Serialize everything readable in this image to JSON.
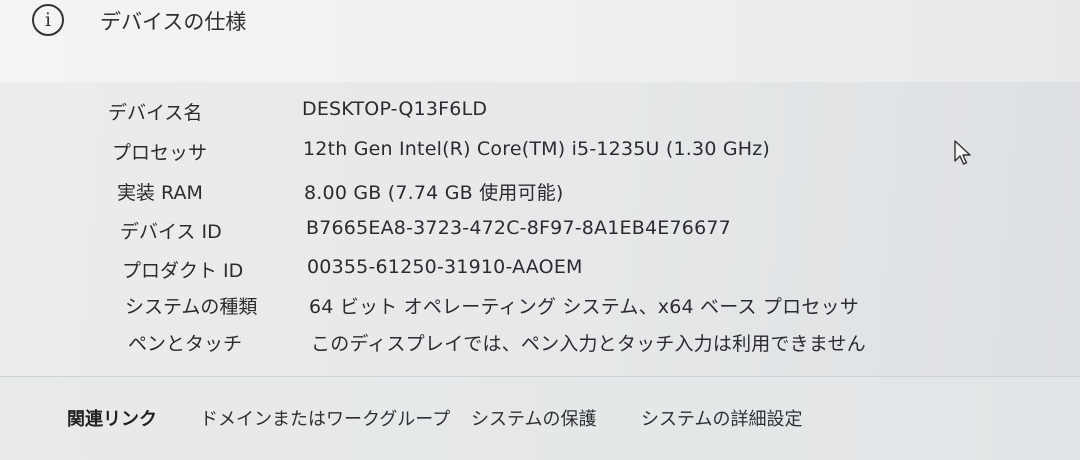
{
  "header": {
    "title": "デバイスの仕様",
    "info_icon": "i"
  },
  "specs": [
    {
      "label": "デバイス名",
      "value": "DESKTOP-Q13F6LD"
    },
    {
      "label": "プロセッサ",
      "value": "12th Gen Intel(R) Core(TM) i5-1235U (1.30 GHz)"
    },
    {
      "label": "実装 RAM",
      "value": "8.00 GB (7.74 GB 使用可能)"
    },
    {
      "label": "デバイス ID",
      "value": "B7665EA8-3723-472C-8F97-8A1EB4E76677"
    },
    {
      "label": "プロダクト ID",
      "value": "00355-61250-31910-AAOEM"
    },
    {
      "label": "システムの種類",
      "value": "64 ビット オペレーティング システム、x64 ベース プロセッサ"
    },
    {
      "label": "ペンとタッチ",
      "value": "このディスプレイでは、ペン入力とタッチ入力は利用できません"
    }
  ],
  "related_links": {
    "heading": "関連リンク",
    "items": [
      "ドメインまたはワークグループ",
      "システムの保護",
      "システムの詳細設定"
    ]
  },
  "icons": {
    "info": "info-icon",
    "cursor": "mouse-pointer-icon"
  }
}
